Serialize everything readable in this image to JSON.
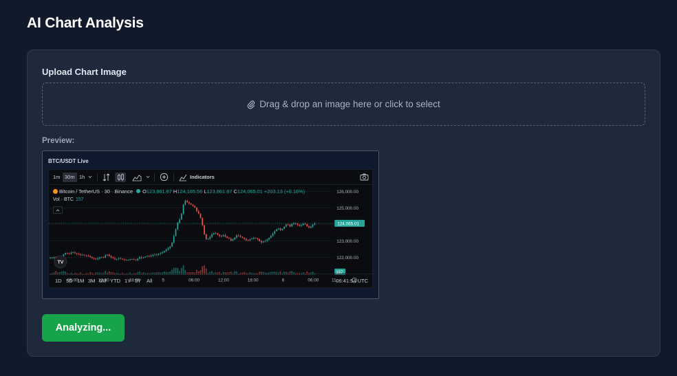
{
  "page": {
    "title": "AI Chart Analysis"
  },
  "upload": {
    "label": "Upload Chart Image",
    "dropzone_text": "Drag & drop an image here or click to select",
    "dropzone_icon": "paperclip-icon"
  },
  "preview": {
    "label": "Preview:",
    "image_title": "BTC/USDT Live",
    "tv": {
      "intervals": [
        "1m",
        "30m",
        "1h"
      ],
      "indicators_label": "Indicators",
      "symbol": "Bitcoin / TetherUS · 30 · Binance",
      "ohlc": {
        "o_label": "O",
        "o": "123,861.87",
        "h_label": "H",
        "h": "124,165.56",
        "l_label": "L",
        "l": "123,861.87",
        "c_label": "C",
        "c": "124,065.01",
        "change": "+203.13 (+0.16%)"
      },
      "vol_label": "Vol · BTC",
      "vol_value": "157",
      "price_label": "124,065.01",
      "vol_badge": "157",
      "ranges": [
        "1D",
        "5D",
        "1M",
        "3M",
        "6M",
        "YTD",
        "1Y",
        "5Y",
        "All"
      ],
      "time": "06:41:54 UTC",
      "logo": "TV",
      "colors": {
        "up": "#26a69a",
        "down": "#ef5350"
      }
    }
  },
  "actions": {
    "analyze_label": "Analyzing..."
  },
  "chart_data": {
    "type": "candlestick",
    "title": "",
    "y_axis_ticks": [
      "126,000.00",
      "125,000.00",
      "124,000.00",
      "123,000.00",
      "122,000.00"
    ],
    "x_axis_ticks": [
      "06:00",
      "12:00",
      "18:00",
      "5",
      "06:00",
      "12:00",
      "18:00",
      "6",
      "06:00",
      "11:"
    ],
    "ylim": [
      121400,
      126300
    ],
    "close_series": [
      121990,
      121960,
      122020,
      121880,
      121810,
      121920,
      122060,
      122180,
      122260,
      122230,
      122210,
      122290,
      122300,
      122250,
      122210,
      122180,
      122140,
      122150,
      122120,
      122100,
      122080,
      122020,
      121960,
      121930,
      121900,
      121930,
      121980,
      122020,
      121990,
      122120,
      122170,
      122080,
      122000,
      121950,
      121880,
      121900,
      121940,
      121910,
      121870,
      121850,
      121820,
      121840,
      121880,
      121890,
      121860,
      121830,
      121920,
      122010,
      121960,
      122000,
      122050,
      122080,
      122060,
      122110,
      122160,
      122190,
      122150,
      122210,
      122260,
      122300,
      122380,
      122480,
      122560,
      122660,
      122900,
      123300,
      123700,
      124100,
      124300,
      124650,
      125200,
      125430,
      125350,
      125280,
      125200,
      125120,
      125020,
      124800,
      124650,
      124400,
      123950,
      123400,
      123100,
      123120,
      123240,
      123400,
      123480,
      123460,
      123380,
      123300,
      123280,
      123350,
      123260,
      123190,
      123140,
      123020,
      123090,
      123200,
      123330,
      123300,
      123240,
      123180,
      123120,
      123040,
      123020,
      123100,
      123130,
      123190,
      123170,
      123110,
      122990,
      122910,
      122970,
      123000,
      123080,
      123180,
      123300,
      123440,
      123590,
      123700,
      123760,
      123660,
      123730,
      123860,
      124000,
      123980,
      123880,
      124020,
      124080,
      124040,
      123980,
      123910,
      123960,
      124030,
      124010,
      123880,
      123800,
      123870,
      124000,
      124065
    ]
  }
}
